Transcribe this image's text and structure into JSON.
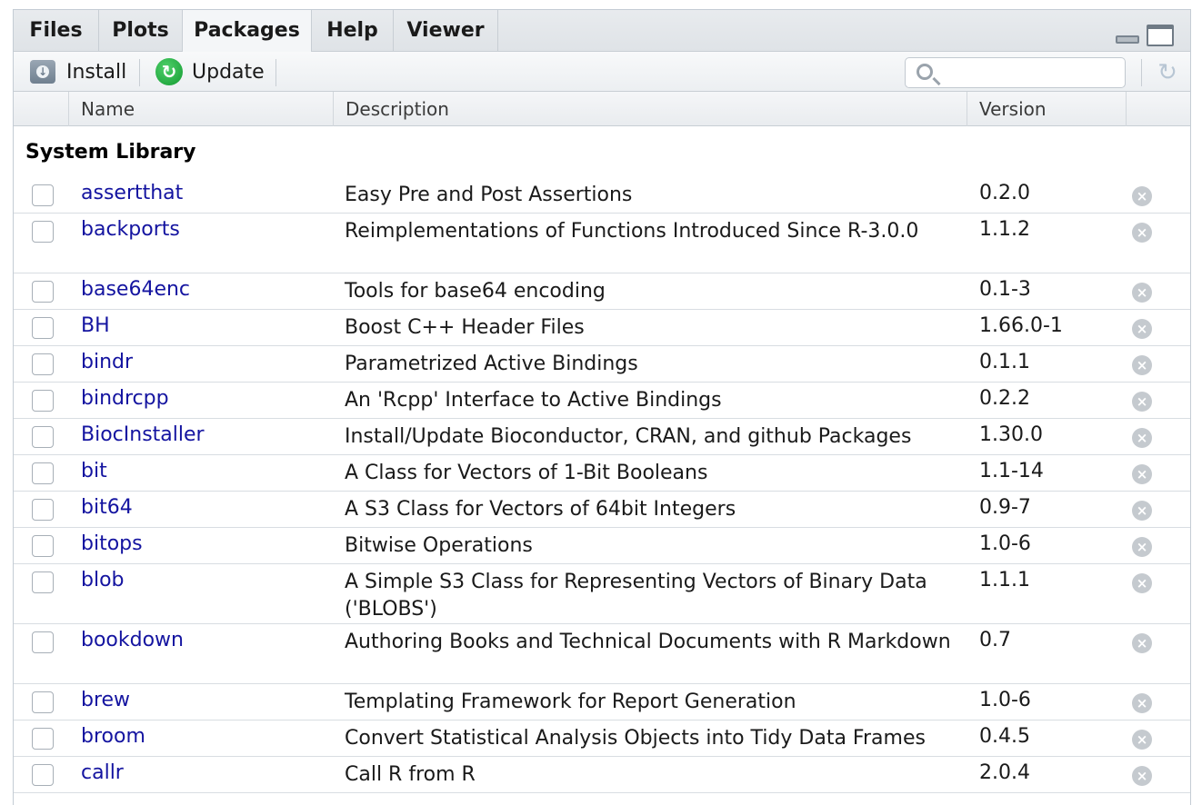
{
  "tabs": [
    {
      "label": "Files",
      "active": false
    },
    {
      "label": "Plots",
      "active": false
    },
    {
      "label": "Packages",
      "active": true
    },
    {
      "label": "Help",
      "active": false
    },
    {
      "label": "Viewer",
      "active": false
    }
  ],
  "toolbar": {
    "install_label": "Install",
    "update_label": "Update",
    "search_placeholder": ""
  },
  "columns": {
    "name": "Name",
    "description": "Description",
    "version": "Version"
  },
  "section_title": "System Library",
  "packages": [
    {
      "name": "assertthat",
      "description": "Easy Pre and Post Assertions",
      "version": "0.2.0"
    },
    {
      "name": "backports",
      "description": "Reimplementations of Functions Introduced Since R-3.0.0",
      "version": "1.1.2"
    },
    {
      "name": "base64enc",
      "description": "Tools for base64 encoding",
      "version": "0.1-3"
    },
    {
      "name": "BH",
      "description": "Boost C++ Header Files",
      "version": "1.66.0-1"
    },
    {
      "name": "bindr",
      "description": "Parametrized Active Bindings",
      "version": "0.1.1"
    },
    {
      "name": "bindrcpp",
      "description": "An 'Rcpp' Interface to Active Bindings",
      "version": "0.2.2"
    },
    {
      "name": "BiocInstaller",
      "description": "Install/Update Bioconductor, CRAN, and github Packages",
      "version": "1.30.0"
    },
    {
      "name": "bit",
      "description": "A Class for Vectors of 1-Bit Booleans",
      "version": "1.1-14"
    },
    {
      "name": "bit64",
      "description": "A S3 Class for Vectors of 64bit Integers",
      "version": "0.9-7"
    },
    {
      "name": "bitops",
      "description": "Bitwise Operations",
      "version": "1.0-6"
    },
    {
      "name": "blob",
      "description": "A Simple S3 Class for Representing Vectors of Binary Data ('BLOBS')",
      "version": "1.1.1"
    },
    {
      "name": "bookdown",
      "description": "Authoring Books and Technical Documents with R Markdown",
      "version": "0.7"
    },
    {
      "name": "brew",
      "description": "Templating Framework for Report Generation",
      "version": "1.0-6"
    },
    {
      "name": "broom",
      "description": "Convert Statistical Analysis Objects into Tidy Data Frames",
      "version": "0.4.5"
    },
    {
      "name": "callr",
      "description": "Call R from R",
      "version": "2.0.4"
    }
  ],
  "colors": {
    "package_link": "#1414a0",
    "update_green": "#139a31"
  }
}
